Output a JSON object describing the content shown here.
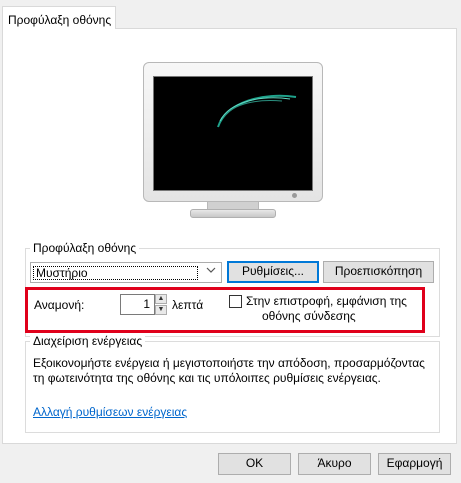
{
  "tabs": [
    {
      "label": "Προφύλαξη οθόνης"
    }
  ],
  "screensaver_group": {
    "title": "Προφύλαξη οθόνης",
    "selected": "Μυστήριο",
    "settings_button": "Ρυθμίσεις...",
    "preview_button": "Προεπισκόπηση"
  },
  "wait": {
    "label": "Αναμονή:",
    "value": "1",
    "unit": "λεπτά",
    "resume_checkbox_label_line1": "Στην επιστροφή, εμφάνιση της",
    "resume_checkbox_label_line2": "οθόνης σύνδεσης",
    "resume_checked": false
  },
  "power_group": {
    "title": "Διαχείριση ενέργειας",
    "description_line1": "Εξοικονομήστε ενέργεια ή μεγιστοποιήστε την απόδοση, προσαρμόζοντας",
    "description_line2": "τη φωτεινότητα της οθόνης και τις υπόλοιπες ρυθμίσεις ενέργειας.",
    "link": "Αλλαγή ρυθμίσεων ενέργειας"
  },
  "footer": {
    "ok": "OK",
    "cancel": "Άκυρο",
    "apply": "Εφαρμογή"
  },
  "colors": {
    "highlight_border": "#e0001b",
    "link": "#0066cc",
    "focus": "#0078d7"
  }
}
